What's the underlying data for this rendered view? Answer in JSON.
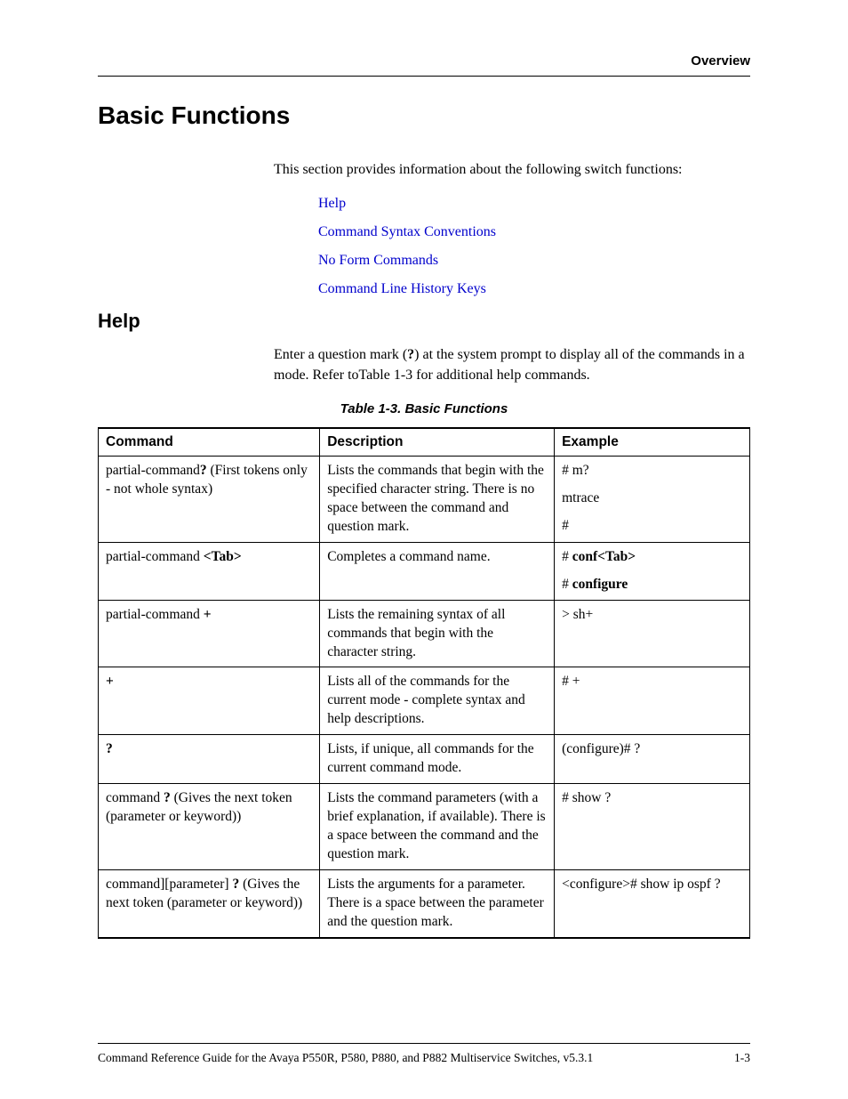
{
  "chapter": "Overview",
  "h1": "Basic Functions",
  "intro": "This section provides information about the following switch functions:",
  "links": [
    "Help",
    "Command Syntax Conventions",
    "No Form Commands",
    "Command Line History Keys"
  ],
  "h2": "Help",
  "help_text_pre": "Enter a question mark (",
  "help_text_mark": "?",
  "help_text_post": ") at the system prompt to display all of the commands in a mode. Refer toTable 1-3 for additional help commands.",
  "table_caption": "Table 1-3.  Basic Functions",
  "headers": {
    "c1": "Command",
    "c2": "Description",
    "c3": "Example"
  },
  "rows": [
    {
      "cmd_pre": "partial-command",
      "cmd_bold": "?",
      "cmd_post": " (First tokens only - not whole syntax)",
      "desc": "Lists the commands that begin with the specified character string. There is no space between the command and question mark.",
      "ex": [
        "# m?",
        "mtrace",
        "#"
      ]
    },
    {
      "cmd_pre": "partial-command ",
      "cmd_bold": "<Tab>",
      "cmd_post": "",
      "desc": "Completes a command name.",
      "ex_html": [
        {
          "pre": "# ",
          "b": "conf<Tab>",
          "post": ""
        },
        {
          "pre": "# ",
          "b": "configure",
          "post": ""
        }
      ]
    },
    {
      "cmd_pre": "partial-command ",
      "cmd_bold": "+",
      "cmd_post": "",
      "desc": "Lists the remaining syntax of all commands that begin with the character string.",
      "ex": [
        "> sh+"
      ]
    },
    {
      "cmd_pre": "",
      "cmd_bold": "+",
      "cmd_post": "",
      "desc": "Lists all of the commands for the current mode - complete syntax and help descriptions.",
      "ex": [
        "# +"
      ]
    },
    {
      "cmd_pre": "",
      "cmd_bold": "?",
      "cmd_post": "",
      "desc": "Lists, if unique, all commands for the current command mode.",
      "ex": [
        "(configure)# ?"
      ]
    },
    {
      "cmd_pre": "command ",
      "cmd_bold": "?",
      "cmd_post": " (Gives the next token (parameter or keyword))",
      "desc": "Lists the command parameters (with a brief explanation, if available). There is a space between the command and the question mark.",
      "ex": [
        "# show ?"
      ]
    },
    {
      "cmd_pre": "command][parameter] ",
      "cmd_bold": "?",
      "cmd_post": " (Gives the next token (parameter or keyword))",
      "desc": "Lists the arguments for a parameter. There is a space between the parameter and the question mark.",
      "ex": [
        "<configure># show ip ospf ?"
      ]
    }
  ],
  "footer_left": "Command Reference Guide for the Avaya P550R, P580, P880, and P882 Multiservice Switches, v5.3.1",
  "footer_right": "1-3"
}
